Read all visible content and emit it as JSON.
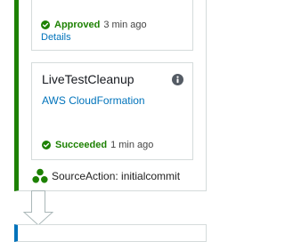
{
  "colors": {
    "success": "#1d8102",
    "link": "#0073bb",
    "border": "#d5dbdb",
    "next_stage_accent": "#0073bb"
  },
  "approval_action": {
    "status_icon": "check-circle-icon",
    "status": "Approved",
    "time": "3 min ago",
    "details_link": "Details"
  },
  "cleanup_action": {
    "title": "LiveTestCleanup",
    "info_icon": "info-circle-icon",
    "provider": "AWS CloudFormation",
    "status_icon": "check-circle-icon",
    "status": "Succeeded",
    "time": "1 min ago"
  },
  "source": {
    "icon": "source-action-icon",
    "label": "SourceAction: initialcommit"
  },
  "transition": {
    "icon": "down-arrow-icon"
  }
}
